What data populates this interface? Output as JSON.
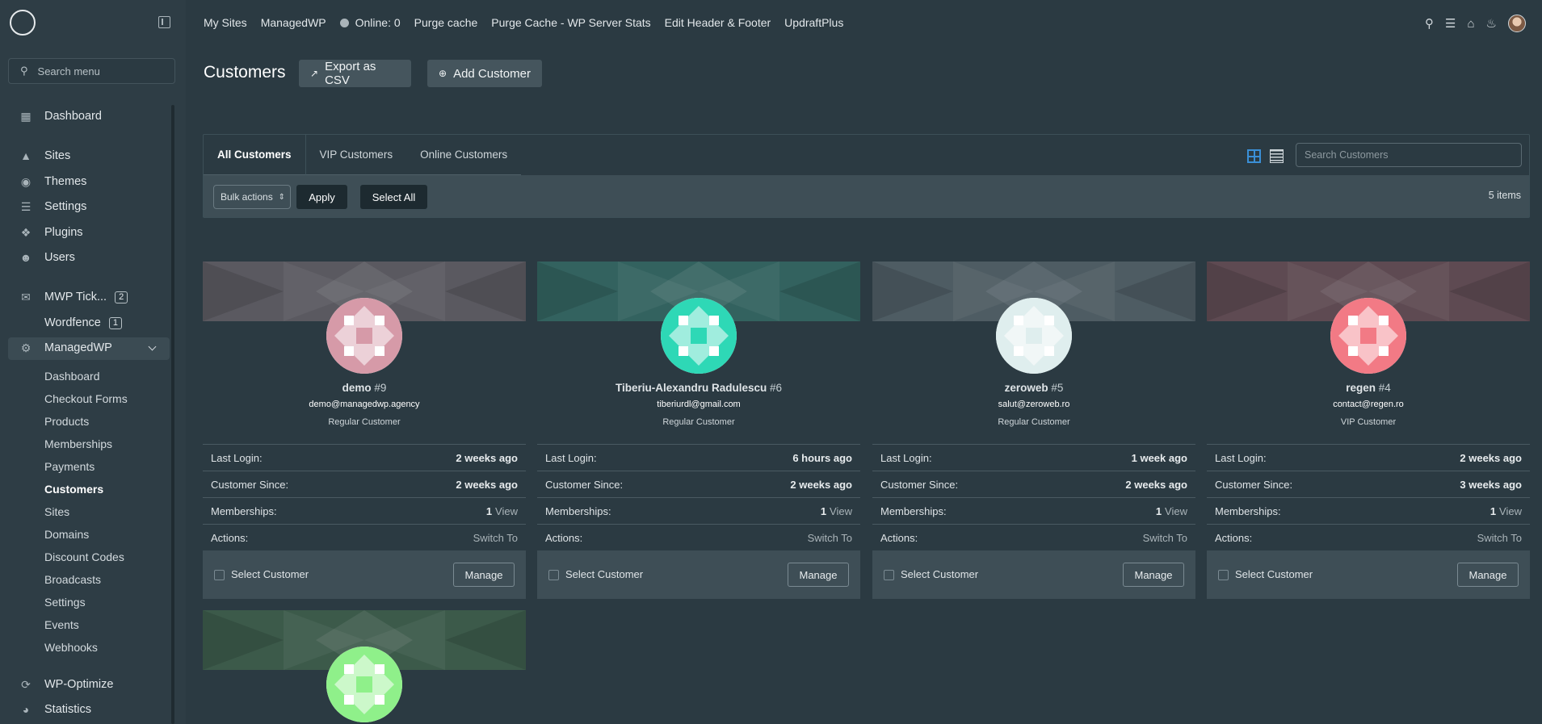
{
  "sidebar": {
    "search_placeholder": "Search menu",
    "items": [
      {
        "label": "Dashboard",
        "icon": "dashboard-icon"
      },
      {
        "label": "Sites",
        "icon": "sites-icon"
      },
      {
        "label": "Themes",
        "icon": "palette-icon"
      },
      {
        "label": "Settings",
        "icon": "sliders-icon"
      },
      {
        "label": "Plugins",
        "icon": "plug-icon"
      },
      {
        "label": "Users",
        "icon": "users-icon"
      },
      {
        "label": "MWP Tick...",
        "icon": "ticket-icon",
        "badge": "2"
      },
      {
        "label": "Wordfence",
        "badge": "1"
      },
      {
        "label": "ManagedWP",
        "icon": "network-icon"
      },
      {
        "label": "WP-Optimize",
        "icon": "optimize-icon"
      },
      {
        "label": "Statistics",
        "icon": "chart-icon"
      }
    ],
    "sub_items": [
      "Dashboard",
      "Checkout Forms",
      "Products",
      "Memberships",
      "Payments",
      "Customers",
      "Sites",
      "Domains",
      "Discount Codes",
      "Broadcasts",
      "Settings",
      "Events",
      "Webhooks"
    ],
    "current_sub": "Customers"
  },
  "topbar": {
    "links": [
      "My Sites",
      "ManagedWP",
      "Online: 0",
      "Purge cache",
      "Purge Cache - WP Server Stats",
      "Edit Header & Footer",
      "UpdraftPlus"
    ]
  },
  "header": {
    "title": "Customers",
    "export_label": "Export as CSV",
    "add_label": "Add Customer"
  },
  "tabs": [
    "All Customers",
    "VIP Customers",
    "Online Customers"
  ],
  "search_placeholder": "Search Customers",
  "bulk": {
    "select_label": "Bulk actions",
    "apply_label": "Apply",
    "select_all_label": "Select All",
    "count": "5 items"
  },
  "labels": {
    "last_login": "Last Login:",
    "customer_since": "Customer Since:",
    "memberships": "Memberships:",
    "actions": "Actions:",
    "view": "View",
    "switch_to": "Switch To",
    "select_customer": "Select Customer",
    "manage": "Manage"
  },
  "customers": [
    {
      "name": "demo",
      "id": "#9",
      "email": "demo@managedwp.agency",
      "type": "Regular Customer",
      "last_login": "2 weeks ago",
      "since": "2 weeks ago",
      "memberships": "1",
      "color": "#d69aa8",
      "banner": "#5a5960"
    },
    {
      "name": "Tiberiu-Alexandru Radulescu",
      "id": "#6",
      "email": "tiberiurdl@gmail.com",
      "type": "Regular Customer",
      "last_login": "6 hours ago",
      "since": "2 weeks ago",
      "memberships": "1",
      "color": "#2ed8b6",
      "banner": "#33625f"
    },
    {
      "name": "zeroweb",
      "id": "#5",
      "email": "salut@zeroweb.ro",
      "type": "Regular Customer",
      "last_login": "1 week ago",
      "since": "2 weeks ago",
      "memberships": "1",
      "color": "#dfeeee",
      "banner": "#4e5c63"
    },
    {
      "name": "regen",
      "id": "#4",
      "email": "contact@regen.ro",
      "type": "VIP Customer",
      "last_login": "2 weeks ago",
      "since": "3 weeks ago",
      "memberships": "1",
      "color": "#f27a85",
      "banner": "#5e4a52"
    },
    {
      "color": "#8ff08a",
      "banner": "#3c5a4a"
    }
  ]
}
